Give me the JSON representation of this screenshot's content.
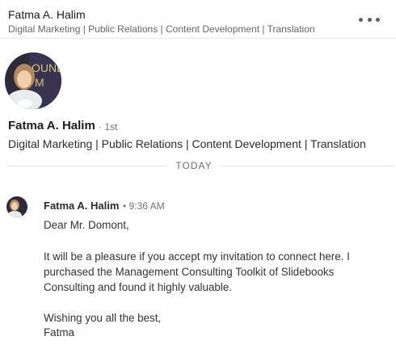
{
  "header": {
    "name": "Fatma A. Halim",
    "headline": "Digital Marketing | Public Relations | Content Development | Translation",
    "more_icon": "ellipsis-icon"
  },
  "profile": {
    "name": "Fatma A. Halim",
    "degree": "· 1st",
    "headline": "Digital Marketing | Public Relations | Content Development | Translation",
    "photo_text": "OUNE M"
  },
  "divider": {
    "label": "TODAY"
  },
  "message": {
    "sender": "Fatma A. Halim",
    "time": "• 9:36 AM",
    "lines": [
      "Dear Mr. Domont,",
      "It will be a pleasure if you accept my invitation to connect here. I",
      "purchased the Management Consulting Toolkit of Slidebooks",
      "Consulting and found it highly valuable.",
      "Wishing you all the best,",
      "Fatma"
    ]
  },
  "colors": {
    "secondary_text": "#666666",
    "divider": "#dcdcdc",
    "photo_bg": "#2d2a3c"
  }
}
